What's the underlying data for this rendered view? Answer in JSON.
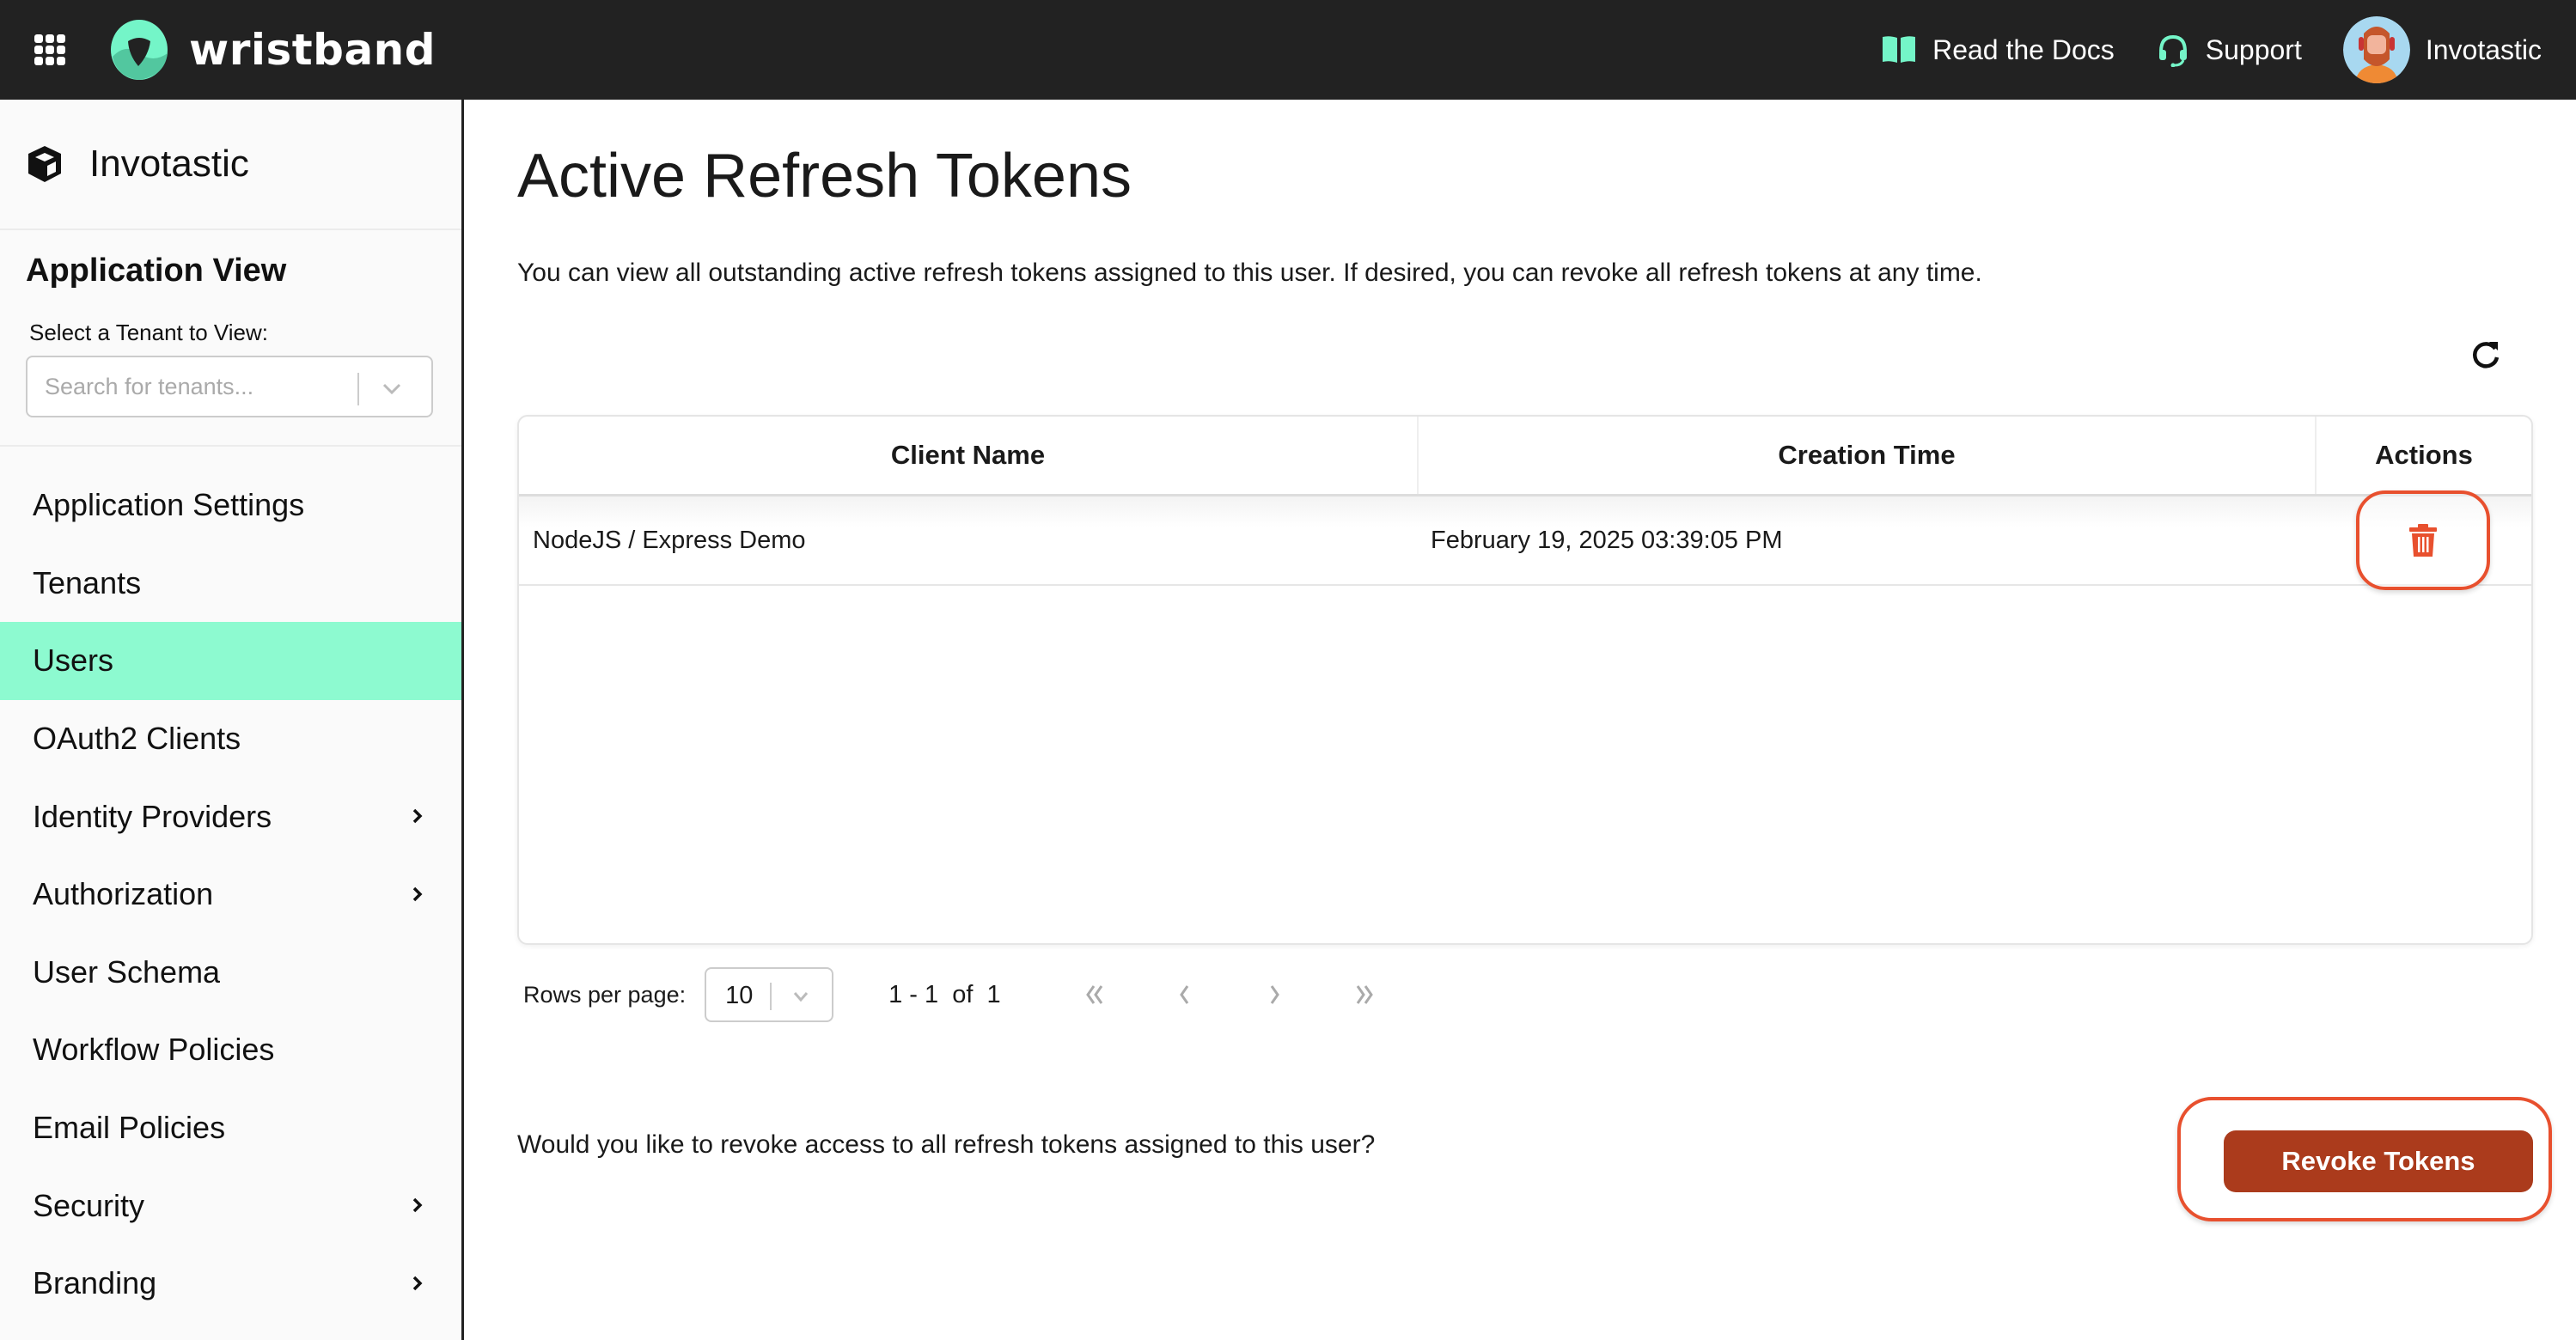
{
  "header": {
    "brand": "wristband",
    "links": [
      {
        "label": "Read the Docs",
        "icon": "book-icon"
      },
      {
        "label": "Support",
        "icon": "headset-icon"
      }
    ],
    "user": {
      "name": "Invotastic",
      "icon": "avatar"
    }
  },
  "colors": {
    "brand_mint": "#8dfad0",
    "topbar": "#222222",
    "danger": "#ab3b1c",
    "highlight_outline": "#e8502e"
  },
  "sidebar": {
    "org_name": "Invotastic",
    "section_title": "Application View",
    "tenant_label": "Select a Tenant to View:",
    "tenant_placeholder": "Search for tenants...",
    "items": [
      {
        "label": "Application Settings",
        "has_children": false,
        "active": false
      },
      {
        "label": "Tenants",
        "has_children": false,
        "active": false
      },
      {
        "label": "Users",
        "has_children": false,
        "active": true
      },
      {
        "label": "OAuth2 Clients",
        "has_children": false,
        "active": false
      },
      {
        "label": "Identity Providers",
        "has_children": true,
        "active": false
      },
      {
        "label": "Authorization",
        "has_children": true,
        "active": false
      },
      {
        "label": "User Schema",
        "has_children": false,
        "active": false
      },
      {
        "label": "Workflow Policies",
        "has_children": false,
        "active": false
      },
      {
        "label": "Email Policies",
        "has_children": false,
        "active": false
      },
      {
        "label": "Security",
        "has_children": true,
        "active": false
      },
      {
        "label": "Branding",
        "has_children": true,
        "active": false
      }
    ]
  },
  "main": {
    "title": "Active Refresh Tokens",
    "description": "You can view all outstanding active refresh tokens assigned to this user. If desired, you can revoke all refresh tokens at any time.",
    "table": {
      "columns": [
        "Client Name",
        "Creation Time",
        "Actions"
      ],
      "rows": [
        {
          "client_name": "NodeJS / Express Demo",
          "creation_time": "February 19, 2025 03:39:05 PM",
          "action_icon": "trash-icon"
        }
      ]
    },
    "pagination": {
      "rows_per_page_label": "Rows per page:",
      "rows_per_page_value": "10",
      "range": "1 - 1  of  1"
    },
    "revoke": {
      "question": "Would you like to revoke access to all refresh tokens assigned to this user?",
      "button_label": "Revoke Tokens"
    }
  }
}
